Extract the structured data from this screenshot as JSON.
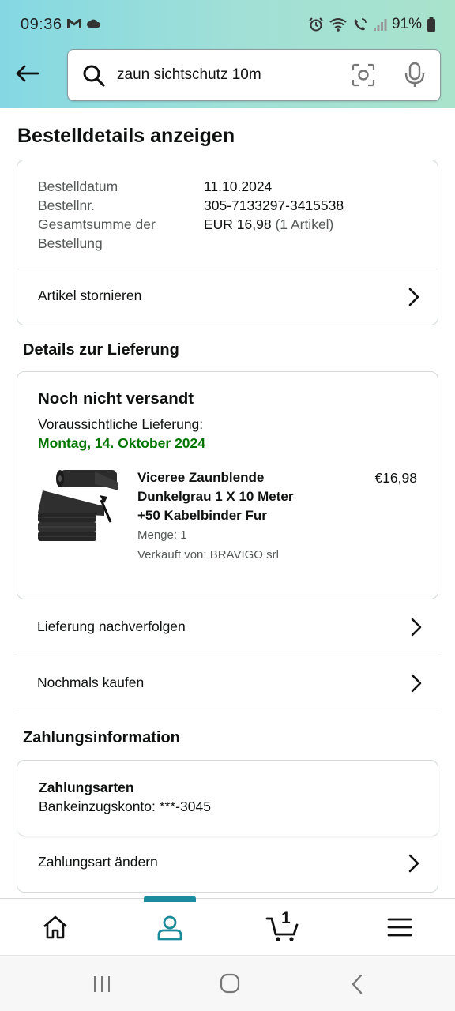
{
  "status_bar": {
    "time": "09:36",
    "battery": "91%"
  },
  "search": {
    "query": "zaun sichtschutz 10m"
  },
  "page": {
    "title": "Bestelldetails anzeigen"
  },
  "order_summary": {
    "rows": [
      {
        "label": "Bestelldatum",
        "value": "11.10.2024"
      },
      {
        "label": "Bestellnr.",
        "value": "305-7133297-3415538"
      }
    ],
    "total_label": "Gesamtsumme der Bestellung",
    "total_value": "EUR 16,98",
    "total_items": "(1 Artikel)",
    "cancel_label": "Artikel stornieren"
  },
  "delivery": {
    "section_title": "Details zur Lieferung",
    "status": "Noch nicht versandt",
    "expected_label": "Voraussichtliche Lieferung:",
    "expected_date": "Montag, 14. Oktober 2024",
    "product": {
      "name": "Viceree Zaunblende Dunkelgrau 1 X 10 Meter +50 Kabelbinder Fur",
      "price": "€16,98",
      "quantity": "Menge: 1",
      "seller": "Verkauft von: BRAVIGO srl"
    },
    "track_label": "Lieferung nachverfolgen",
    "buy_again_label": "Nochmals kaufen"
  },
  "payment": {
    "section_title": "Zahlungsinformation",
    "methods_label": "Zahlungsarten",
    "account": "Bankeinzugskonto: ***-3045",
    "change_label": "Zahlungsart ändern"
  },
  "bottom_nav": {
    "cart_count": "1"
  },
  "colors": {
    "header_gradient_start": "#84d8e3",
    "header_gradient_end": "#a9e3cc",
    "delivery_date_green": "#007600",
    "nav_accent": "#1b8c9c"
  }
}
